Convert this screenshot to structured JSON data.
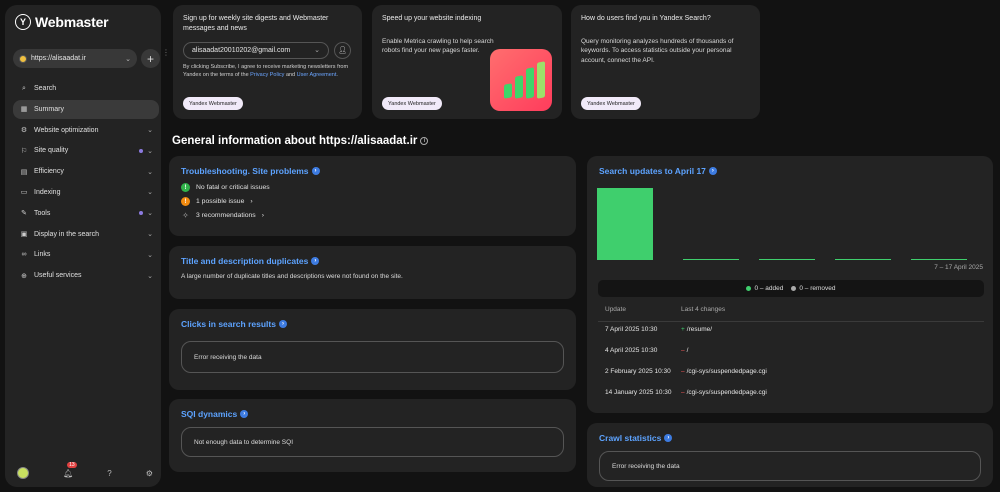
{
  "sidebar": {
    "brand": "Webmaster",
    "site": "https://alisaadat.ir",
    "items": [
      {
        "label": "Search",
        "icon": "search-icon"
      },
      {
        "label": "Summary",
        "icon": "grid-icon"
      },
      {
        "label": "Website optimization",
        "icon": "tool-icon"
      },
      {
        "label": "Site quality",
        "icon": "quality-icon"
      },
      {
        "label": "Efficiency",
        "icon": "chart-icon"
      },
      {
        "label": "Indexing",
        "icon": "index-icon"
      },
      {
        "label": "Tools",
        "icon": "wrench-icon"
      },
      {
        "label": "Display in the search",
        "icon": "display-icon"
      },
      {
        "label": "Links",
        "icon": "link-icon"
      },
      {
        "label": "Useful services",
        "icon": "services-icon"
      }
    ],
    "notification_count": "13"
  },
  "promo": {
    "subscribe": {
      "title": "Sign up for weekly site digests and Webmaster messages and news",
      "email": "alisaadat20010202@gmail.com",
      "legal_prefix": "By clicking Subscribe, I agree to receive marketing newsletters from Yandex on the terms of the",
      "privacy_link": "Privacy Policy",
      "and": "and",
      "user_link": "User Agreement",
      "legal_suffix": ".",
      "chip": "Yandex Webmaster"
    },
    "indexing": {
      "title": "Speed up your website indexing",
      "text": "Enable Metrica crawling to help search robots find your new pages faster.",
      "chip": "Yandex Webmaster"
    },
    "queries": {
      "title": "How do users find you in Yandex Search?",
      "text": "Query monitoring analyzes hundreds of thousands of keywords. To access statistics outside your personal account, connect the API.",
      "chip": "Yandex Webmaster"
    }
  },
  "page_title": "General information about https://alisaadat.ir",
  "troubleshooting": {
    "title": "Troubleshooting. Site problems",
    "no_issues": "No fatal or critical issues",
    "possible": "1 possible issue",
    "recommendations": "3 recommendations"
  },
  "duplicates": {
    "title": "Title and description duplicates",
    "text": "A large number of duplicate titles and descriptions were not found on the site."
  },
  "clicks": {
    "title": "Clicks in search results",
    "error": "Error receiving the data"
  },
  "sqi": {
    "title": "SQI dynamics",
    "message": "Not enough data to determine SQI"
  },
  "search_updates": {
    "title": "Search updates to April 17",
    "range": "7 – 17 April 2025",
    "legend_added": "0 – added",
    "legend_removed": "0 – removed",
    "col_update": "Update",
    "col_changes": "Last 4 changes",
    "rows": [
      {
        "date": "7 April 2025 10:30",
        "sign": "+",
        "path": "/resume/"
      },
      {
        "date": "4 April 2025 10:30",
        "sign": "–",
        "path": "/"
      },
      {
        "date": "2 February 2025 10:30",
        "sign": "–",
        "path": "/cgi-sys/suspendedpage.cgi"
      },
      {
        "date": "14 January 2025 10:30",
        "sign": "–",
        "path": "/cgi-sys/suspendedpage.cgi"
      }
    ]
  },
  "chart_data": {
    "type": "bar",
    "categories": [
      "1",
      "2",
      "3",
      "4",
      "5"
    ],
    "values": [
      100,
      2,
      2,
      2,
      2
    ],
    "title": "Search updates to April 17",
    "xlabel": "7 – 17 April 2025",
    "ylabel": "",
    "ylim": [
      0,
      100
    ]
  },
  "crawl": {
    "title": "Crawl statistics",
    "error": "Error receiving the data"
  },
  "colors": {
    "accent": "#5da3ff",
    "added": "#3fcf6d",
    "removed": "#ff5a5a"
  }
}
